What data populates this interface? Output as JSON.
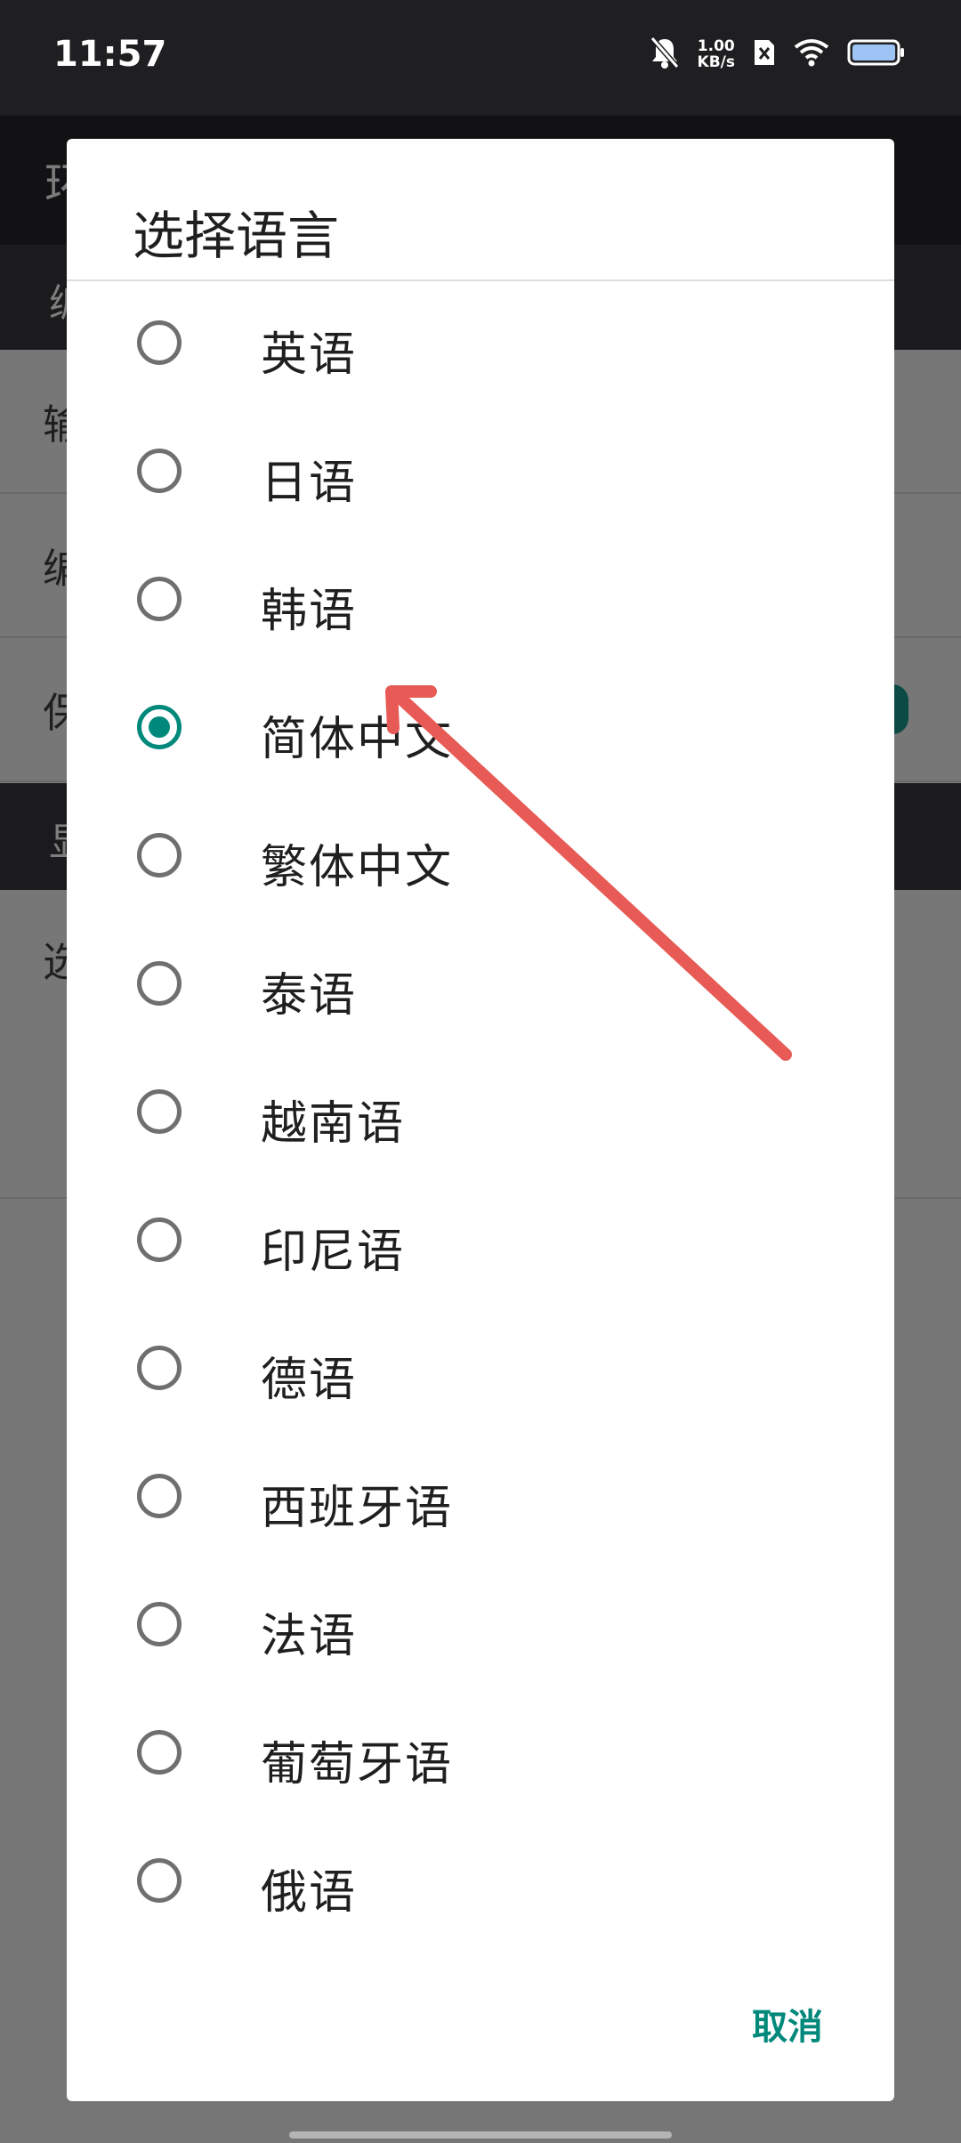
{
  "status_bar": {
    "time": "11:57",
    "net_speed_value": "1.00",
    "net_speed_unit": "KB/s",
    "icons": [
      "bell-off-icon",
      "net-speed",
      "sim-x-icon",
      "wifi-icon",
      "battery-icon"
    ]
  },
  "background": {
    "title": "环",
    "section1": "编",
    "rows": [
      "输",
      "编",
      "保"
    ],
    "section2": "显",
    "last_row": "选"
  },
  "dialog": {
    "title": "选择语言",
    "options": [
      {
        "label": "英语",
        "checked": false
      },
      {
        "label": "日语",
        "checked": false
      },
      {
        "label": "韩语",
        "checked": false
      },
      {
        "label": "简体中文",
        "checked": true
      },
      {
        "label": "繁体中文",
        "checked": false
      },
      {
        "label": "泰语",
        "checked": false
      },
      {
        "label": "越南语",
        "checked": false
      },
      {
        "label": "印尼语",
        "checked": false
      },
      {
        "label": "德语",
        "checked": false
      },
      {
        "label": "西班牙语",
        "checked": false
      },
      {
        "label": "法语",
        "checked": false
      },
      {
        "label": "葡萄牙语",
        "checked": false
      },
      {
        "label": "俄语",
        "checked": false
      }
    ],
    "cancel_label": "取消"
  },
  "colors": {
    "accent": "#00897b",
    "annotation_arrow": "#e85a55",
    "status_bar_bg": "#1f1f21",
    "scrim": "#767676"
  }
}
